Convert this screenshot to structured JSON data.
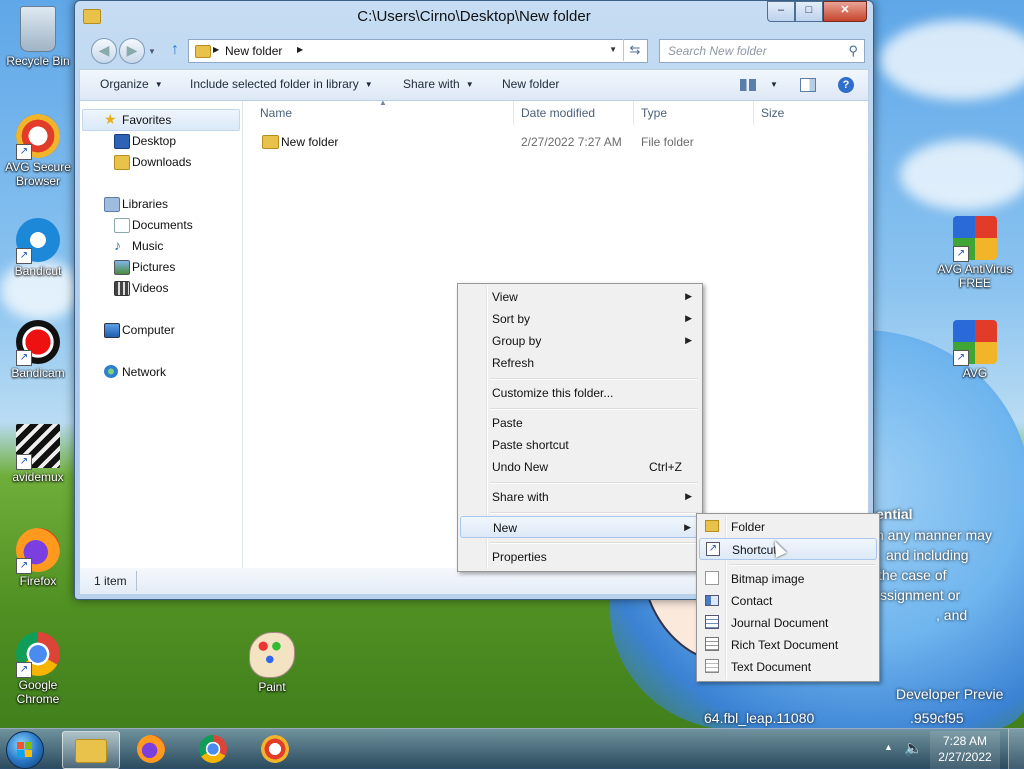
{
  "desktop": {
    "icons": [
      {
        "label": "Recycle Bin"
      },
      {
        "label": "AVG Secure Browser"
      },
      {
        "label": "Bandicut"
      },
      {
        "label": "Bandicam"
      },
      {
        "label": "avidemux"
      },
      {
        "label": "Firefox"
      },
      {
        "label": "Google Chrome"
      },
      {
        "label": "Paint"
      },
      {
        "label": "AVG AntiVirus FREE"
      },
      {
        "label": "AVG"
      }
    ],
    "wallpaper_text": {
      "line1": "ential",
      "line2": "n any manner may",
      "line3": "and including",
      "line4": "the case of",
      "line5": "ssignment or",
      "line6": ", and",
      "line7": "Developer Previe",
      "line8": "64.fbl_leap.11080",
      "line9": ".959cf95"
    }
  },
  "window": {
    "title": "C:\\Users\\Cirno\\Desktop\\New folder",
    "address": {
      "crumb": "New folder"
    },
    "search": {
      "placeholder": "Search New folder"
    },
    "toolbar": {
      "organize": "Organize",
      "include": "Include selected folder in library",
      "share": "Share with",
      "new_folder": "New folder"
    },
    "nav": {
      "favorites": "Favorites",
      "desktop": "Desktop",
      "downloads": "Downloads",
      "libraries": "Libraries",
      "documents": "Documents",
      "music": "Music",
      "pictures": "Pictures",
      "videos": "Videos",
      "computer": "Computer",
      "network": "Network"
    },
    "columns": {
      "name": "Name",
      "date": "Date modified",
      "type": "Type",
      "size": "Size"
    },
    "files": [
      {
        "name": "New folder",
        "date": "2/27/2022 7:27 AM",
        "type": "File folder",
        "size": ""
      }
    ],
    "status": "1 item"
  },
  "context_menu": {
    "items": [
      {
        "label": "View"
      },
      {
        "label": "Sort by"
      },
      {
        "label": "Group by"
      },
      {
        "label": "Refresh"
      },
      {
        "label": "Customize this folder..."
      },
      {
        "label": "Paste"
      },
      {
        "label": "Paste shortcut"
      },
      {
        "label": "Undo New",
        "shortcut": "Ctrl+Z"
      },
      {
        "label": "Share with"
      },
      {
        "label": "New"
      },
      {
        "label": "Properties"
      }
    ]
  },
  "new_submenu": {
    "items": [
      {
        "label": "Folder"
      },
      {
        "label": "Shortcut"
      },
      {
        "label": "Bitmap image"
      },
      {
        "label": "Contact"
      },
      {
        "label": "Journal Document"
      },
      {
        "label": "Rich Text Document"
      },
      {
        "label": "Text Document"
      }
    ]
  },
  "taskbar": {
    "clock_time": "7:28 AM",
    "clock_date": "2/27/2022"
  },
  "colors": {
    "folder": "#e9c24b",
    "highlight": "#dde9f7",
    "menu_bg": "#f0f0f0"
  }
}
